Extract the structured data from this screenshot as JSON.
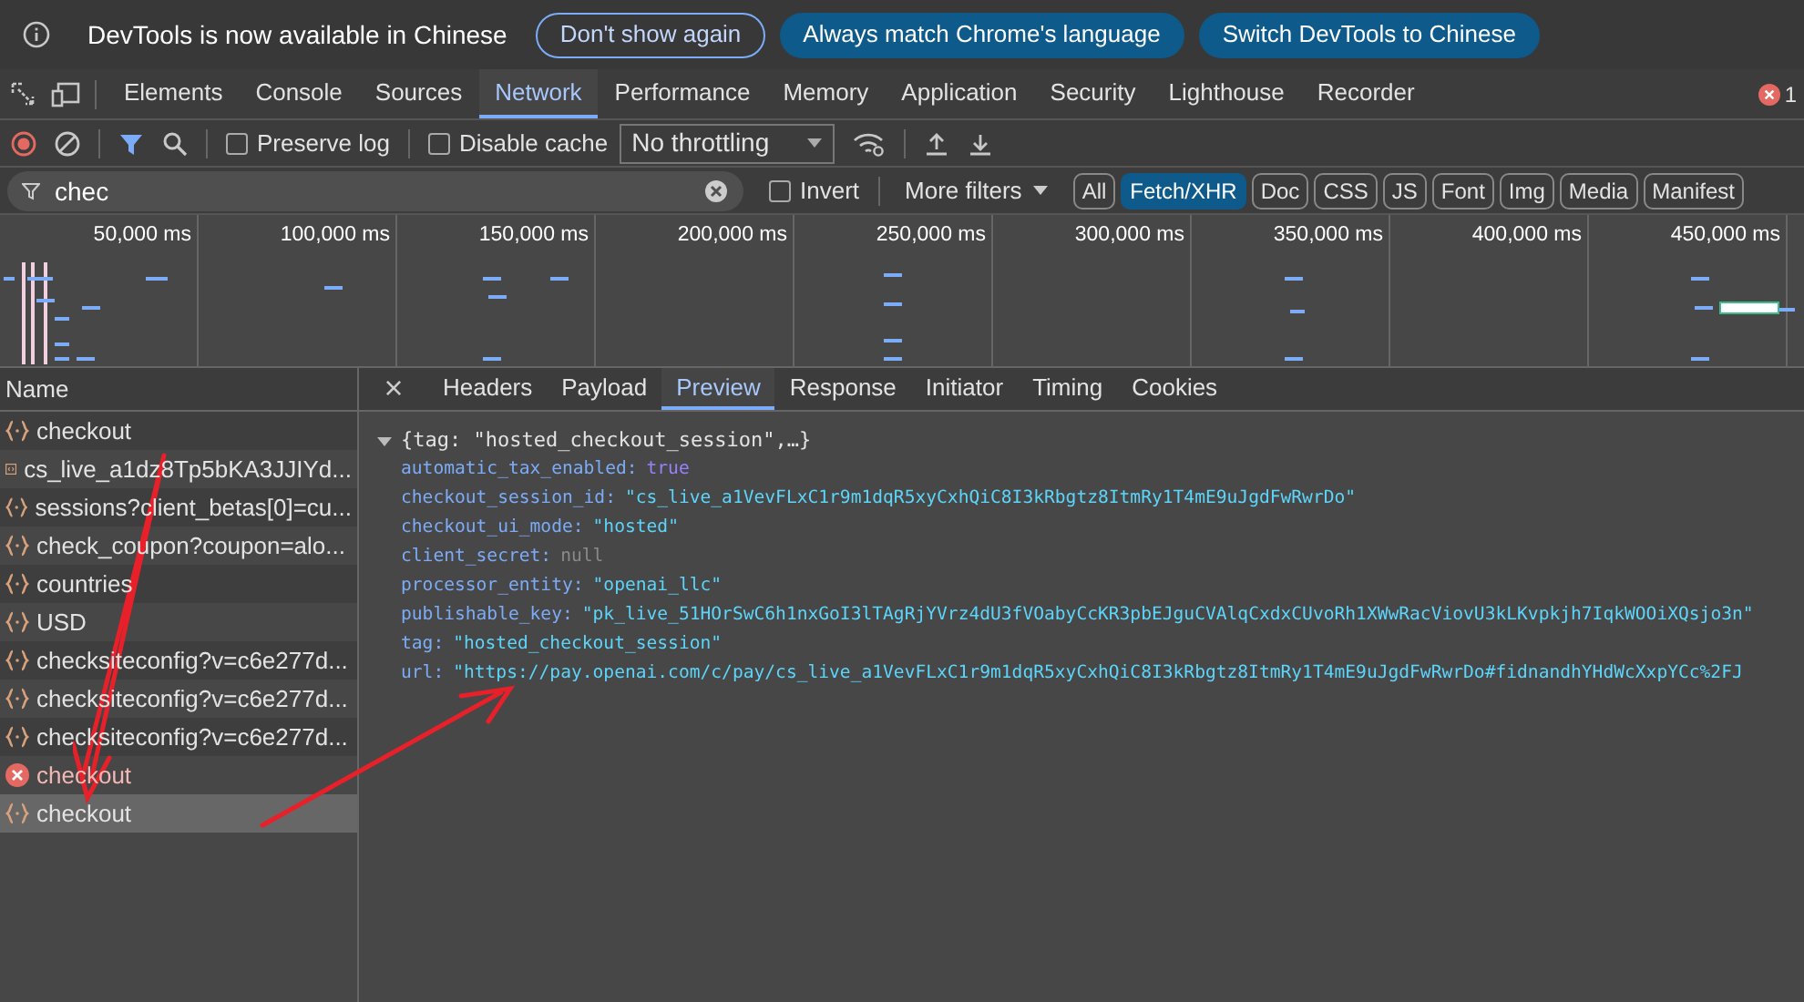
{
  "infobar": {
    "message": "DevTools is now available in Chinese",
    "buttons": [
      {
        "label": "Don't show again",
        "kind": "outline"
      },
      {
        "label": "Always match Chrome's language",
        "kind": "filled"
      },
      {
        "label": "Switch DevTools to Chinese",
        "kind": "filled"
      }
    ]
  },
  "tabs": [
    {
      "label": "Elements",
      "selected": false
    },
    {
      "label": "Console",
      "selected": false
    },
    {
      "label": "Sources",
      "selected": false
    },
    {
      "label": "Network",
      "selected": true
    },
    {
      "label": "Performance",
      "selected": false
    },
    {
      "label": "Memory",
      "selected": false
    },
    {
      "label": "Application",
      "selected": false
    },
    {
      "label": "Security",
      "selected": false
    },
    {
      "label": "Lighthouse",
      "selected": false
    },
    {
      "label": "Recorder",
      "selected": false
    }
  ],
  "error_count": "1",
  "toolbar": {
    "preserve_log": {
      "label": "Preserve log",
      "checked": false
    },
    "disable_cache": {
      "label": "Disable cache",
      "checked": false
    },
    "throttling": "No throttling"
  },
  "filter": {
    "value": "chec",
    "invert": {
      "label": "Invert",
      "checked": false
    },
    "more_filters": "More filters",
    "types": [
      {
        "label": "All",
        "selected": false
      },
      {
        "label": "Fetch/XHR",
        "selected": true
      },
      {
        "label": "Doc",
        "selected": false
      },
      {
        "label": "CSS",
        "selected": false
      },
      {
        "label": "JS",
        "selected": false
      },
      {
        "label": "Font",
        "selected": false
      },
      {
        "label": "Img",
        "selected": false
      },
      {
        "label": "Media",
        "selected": false
      },
      {
        "label": "Manifest",
        "selected": false
      }
    ]
  },
  "timeline": {
    "ticks": [
      "50,000 ms",
      "100,000 ms",
      "150,000 ms",
      "200,000 ms",
      "250,000 ms",
      "300,000 ms",
      "350,000 ms",
      "400,000 ms",
      "450,000 ms"
    ]
  },
  "requests": {
    "column": "Name",
    "rows": [
      {
        "name": "checkout",
        "kind": "fetch",
        "error": false,
        "selected": false
      },
      {
        "name": "cs_live_a1dz8Tp5bKA3JJIYd...",
        "kind": "doc",
        "error": false,
        "selected": false
      },
      {
        "name": "sessions?client_betas[0]=cu...",
        "kind": "fetch",
        "error": false,
        "selected": false
      },
      {
        "name": "check_coupon?coupon=alo...",
        "kind": "fetch",
        "error": false,
        "selected": false
      },
      {
        "name": "countries",
        "kind": "fetch",
        "error": false,
        "selected": false
      },
      {
        "name": "USD",
        "kind": "fetch",
        "error": false,
        "selected": false
      },
      {
        "name": "checksiteconfig?v=c6e277d...",
        "kind": "fetch",
        "error": false,
        "selected": false
      },
      {
        "name": "checksiteconfig?v=c6e277d...",
        "kind": "fetch",
        "error": false,
        "selected": false
      },
      {
        "name": "checksiteconfig?v=c6e277d...",
        "kind": "fetch",
        "error": false,
        "selected": false
      },
      {
        "name": "checkout",
        "error": true,
        "selected": false
      },
      {
        "name": "checkout",
        "kind": "fetch",
        "error": false,
        "selected": true
      }
    ]
  },
  "detail": {
    "close": "×",
    "tabs": [
      {
        "label": "Headers",
        "selected": false
      },
      {
        "label": "Payload",
        "selected": false
      },
      {
        "label": "Preview",
        "selected": true
      },
      {
        "label": "Response",
        "selected": false
      },
      {
        "label": "Initiator",
        "selected": false
      },
      {
        "label": "Timing",
        "selected": false
      },
      {
        "label": "Cookies",
        "selected": false
      }
    ],
    "preview": {
      "summary": "{tag: \"hosted_checkout_session\",…}",
      "expanded": true,
      "properties": [
        {
          "key": "automatic_tax_enabled:",
          "value": "true",
          "kind": "boolean"
        },
        {
          "key": "checkout_session_id:",
          "value": "\"cs_live_a1VevFLxC1r9m1dqR5xyCxhQiC8I3kRbgtz8ItmRy1T4mE9uJgdFwRwrDo\"",
          "kind": "string"
        },
        {
          "key": "checkout_ui_mode:",
          "value": "\"hosted\"",
          "kind": "string"
        },
        {
          "key": "client_secret:",
          "value": "null",
          "kind": "null"
        },
        {
          "key": "processor_entity:",
          "value": "\"openai_llc\"",
          "kind": "string"
        },
        {
          "key": "publishable_key:",
          "value": "\"pk_live_51HOrSwC6h1nxGoI3lTAgRjYVrz4dU3fVOabyCcKR3pbEJguCVAlqCxdxCUvoRh1XWwRacViovU3kLKvpkjh7IqkWOOiXQsjo3n\"",
          "kind": "string"
        },
        {
          "key": "tag:",
          "value": "\"hosted_checkout_session\"",
          "kind": "string"
        },
        {
          "key": "url:",
          "value": "\"https://pay.openai.com/c/pay/cs_live_a1VevFLxC1r9m1dqR5xyCxhQiC8I3kRbgtz8ItmRy1T4mE9uJgdFwRwrDo#fidnandhYHdWcXxpYCc%2FJ",
          "kind": "string"
        }
      ]
    }
  }
}
